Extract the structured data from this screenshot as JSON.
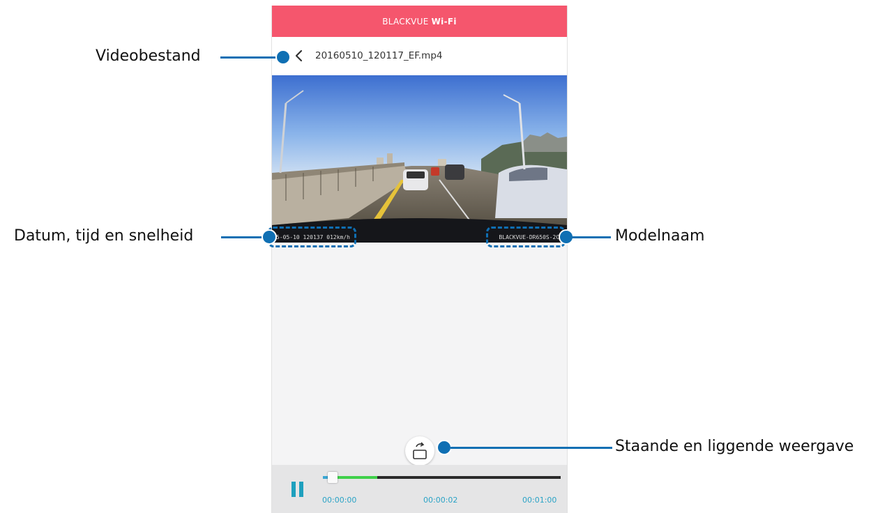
{
  "header": {
    "brand": "BLACKVUE",
    "brand_suffix": "Wi-Fi"
  },
  "file_bar": {
    "file_name": "20160510_120117_EF.mp4"
  },
  "video": {
    "osd_left": "5-05-10 120137 012km/h",
    "osd_right": "BLACKVUE-DR650S-2CH"
  },
  "player": {
    "time_start": "00:00:00",
    "time_current": "00:00:02",
    "time_end": "00:01:00",
    "played_fraction": 0.03,
    "buffered_fraction": 0.23
  },
  "annotations": {
    "video_file": "Videobestand",
    "date_time_speed": "Datum, tijd en snelheid",
    "model_name": "Modelnaam",
    "orientation": "Staande en liggende weergave"
  },
  "colors": {
    "header": "#f5566d",
    "accent": "#1fa0be",
    "progress_buffer": "#3fd04a",
    "callout": "#0f6fb3"
  },
  "icons": {
    "back": "chevron-left-icon",
    "rotate": "rotate-screen-icon",
    "pause": "pause-icon"
  }
}
